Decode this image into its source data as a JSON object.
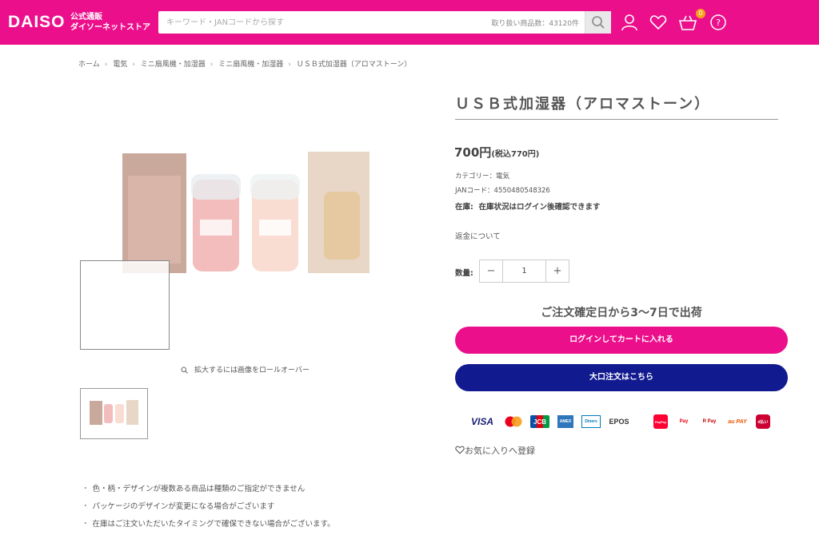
{
  "header": {
    "logo": "DAISO",
    "logo_sub_1": "公式通販",
    "logo_sub_2": "ダイソーネットストア",
    "search_placeholder": "キーワード・JANコードから探す",
    "search_count": "取り扱い商品数：43120件",
    "cart_count": "0",
    "brand_color": "#ec0f8c"
  },
  "breadcrumb": [
    "ホーム",
    "電気",
    "ミニ扇風機・加湿器",
    "ミニ扇風機・加湿器",
    "ＵＳＢ式加湿器（アロマストーン）"
  ],
  "gallery": {
    "zoom_hint": "拡大するには画像をロールオーバー"
  },
  "product": {
    "title": "ＵＳＢ式加湿器（アロマストーン）",
    "price": "700円",
    "price_tax": "(税込770円)",
    "category": "カテゴリー：電気",
    "jan": "JANコード：4550480548326",
    "stock_label": "在庫:",
    "stock_value": "在庫状況はログイン後確認できます",
    "refund": "返金について",
    "qty_label": "数量:",
    "qty_value": "1",
    "ship": "ご注文確定日から3〜7日で出荷",
    "login_cart": "ログインしてカートに入れる",
    "bulk_order": "大口注文はこちら",
    "favorite": "お気に入りへ登録"
  },
  "payments": [
    "VISA",
    "mastercard",
    "JCB",
    "AMEX",
    "Diners",
    "EPOS",
    "PayPay",
    "Pay",
    "R Pay",
    "au PAY",
    "d払い"
  ],
  "notes": [
    "色・柄・デザインが複数ある商品は種類のご指定ができません",
    "パッケージのデザインが変更になる場合がございます",
    "在庫はご注文いただいたタイミングで確保できない場合がございます。"
  ]
}
